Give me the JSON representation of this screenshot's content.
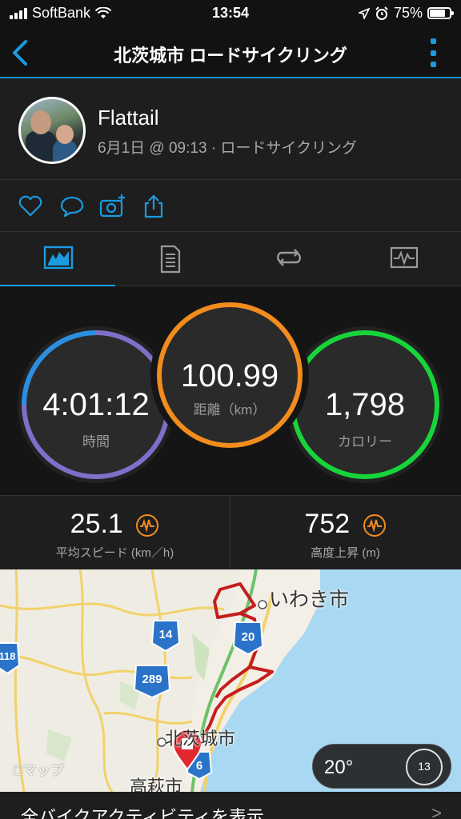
{
  "status": {
    "carrier": "SoftBank",
    "time": "13:54",
    "battery": "75%",
    "icons": [
      "signal-icon",
      "wifi-icon",
      "location-icon",
      "alarm-icon",
      "battery-icon"
    ]
  },
  "nav": {
    "title": "北茨城市 ロードサイクリング",
    "accent": "#1a9be0"
  },
  "profile": {
    "name": "Flattail",
    "meta": "6月1日 @ 09:13 · ロードサイクリング"
  },
  "actions": [
    "like-icon",
    "comment-icon",
    "add-photo-icon",
    "share-icon"
  ],
  "tabs": [
    "overview-tab",
    "details-tab",
    "laps-tab",
    "charts-tab"
  ],
  "rings": {
    "time": {
      "value": "4:01:12",
      "label": "時間",
      "color": "#7e6fc9"
    },
    "distance": {
      "value": "100.99",
      "label": "距離（km）",
      "color": "#f28c1e"
    },
    "calories": {
      "value": "1,798",
      "label": "カロリー",
      "color": "#17d43a"
    }
  },
  "stats": {
    "speed": {
      "value": "25.1",
      "label": "平均スピード (km／h)"
    },
    "ascent": {
      "value": "752",
      "label": "高度上昇 (m)"
    }
  },
  "map": {
    "labels": {
      "iwaki": "いわき市",
      "kitaibaraki": "北茨城市",
      "takahagi": "高萩市"
    },
    "routes": {
      "r118": "118",
      "r14": "14",
      "r20": "20",
      "r289": "289",
      "r6": "6"
    },
    "attribution": "マップ",
    "weather": {
      "temp": "20°",
      "wind": "13"
    }
  },
  "footer": {
    "text": "全バイクアクティビティを表示",
    "chevron": ">"
  }
}
